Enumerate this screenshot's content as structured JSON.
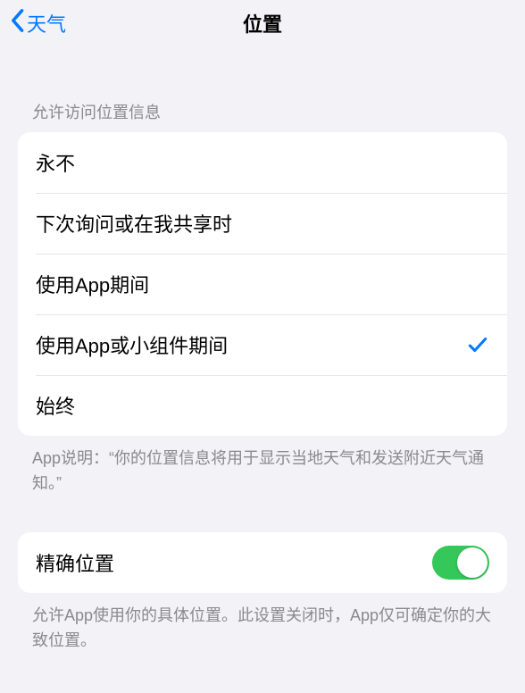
{
  "nav": {
    "back_label": "天气",
    "title": "位置"
  },
  "access": {
    "header": "允许访问位置信息",
    "options": {
      "never": "永不",
      "ask": "下次询问或在我共享时",
      "while_using": "使用App期间",
      "while_using_widgets": "使用App或小组件期间",
      "always": "始终"
    },
    "selected": "while_using_widgets",
    "footer": "App说明：“你的位置信息将用于显示当地天气和发送附近天气通知。”"
  },
  "precise": {
    "label": "精确位置",
    "enabled": true,
    "footer": "允许App使用你的具体位置。此设置关闭时，App仅可确定你的大致位置。"
  }
}
